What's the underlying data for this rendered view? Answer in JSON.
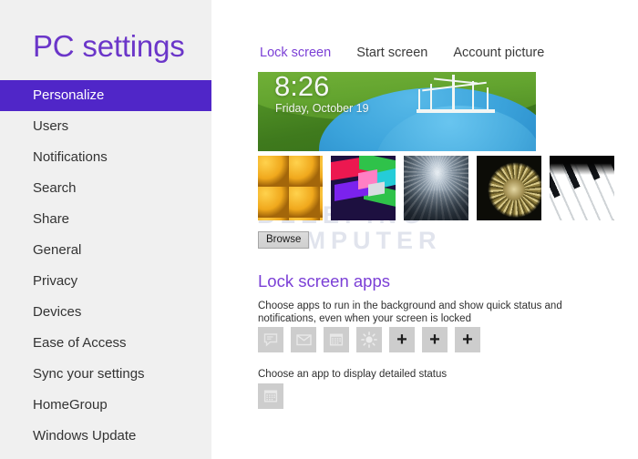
{
  "sidebar": {
    "title": "PC settings",
    "items": [
      {
        "label": "Personalize",
        "selected": true
      },
      {
        "label": "Users",
        "selected": false
      },
      {
        "label": "Notifications",
        "selected": false
      },
      {
        "label": "Search",
        "selected": false
      },
      {
        "label": "Share",
        "selected": false
      },
      {
        "label": "General",
        "selected": false
      },
      {
        "label": "Privacy",
        "selected": false
      },
      {
        "label": "Devices",
        "selected": false
      },
      {
        "label": "Ease of Access",
        "selected": false
      },
      {
        "label": "Sync your settings",
        "selected": false
      },
      {
        "label": "HomeGroup",
        "selected": false
      },
      {
        "label": "Windows Update",
        "selected": false
      }
    ],
    "background_color": "#f0f0f0",
    "selected_color": "#5026c8",
    "title_color": "#6b36c9"
  },
  "tabs": [
    {
      "label": "Lock screen",
      "active": true
    },
    {
      "label": "Start screen",
      "active": false
    },
    {
      "label": "Account picture",
      "active": false
    }
  ],
  "preview": {
    "name": "lock-screen-preview",
    "clock": "8:26",
    "date": "Friday, October 19",
    "description": "Green hillside with blue lagoon and white pavilion"
  },
  "watermark": {
    "line1": "BLEEPING",
    "line2": "COMPUTER"
  },
  "thumbnails": [
    {
      "name": "honeycomb-amber",
      "selected": false
    },
    {
      "name": "geometric-color",
      "selected": false
    },
    {
      "name": "tunnel-architecture",
      "selected": false
    },
    {
      "name": "nautilus-shell",
      "selected": false
    },
    {
      "name": "piano-keys",
      "selected": false
    }
  ],
  "browse": {
    "label": "Browse"
  },
  "lock_screen_apps": {
    "heading": "Lock screen apps",
    "description": "Choose apps to run in the background and show quick status and notifications, even when your screen is locked",
    "tiles": [
      {
        "icon": "messaging-icon",
        "type": "app"
      },
      {
        "icon": "mail-icon",
        "type": "app"
      },
      {
        "icon": "calendar-icon",
        "type": "app"
      },
      {
        "icon": "weather-sun-icon",
        "type": "app"
      },
      {
        "icon": "plus-icon",
        "type": "add",
        "label": "+"
      },
      {
        "icon": "plus-icon",
        "type": "add",
        "label": "+"
      },
      {
        "icon": "plus-icon",
        "type": "add",
        "label": "+"
      }
    ]
  },
  "detailed_status": {
    "label": "Choose an app to display detailed status",
    "tile": {
      "icon": "calendar-icon"
    }
  }
}
